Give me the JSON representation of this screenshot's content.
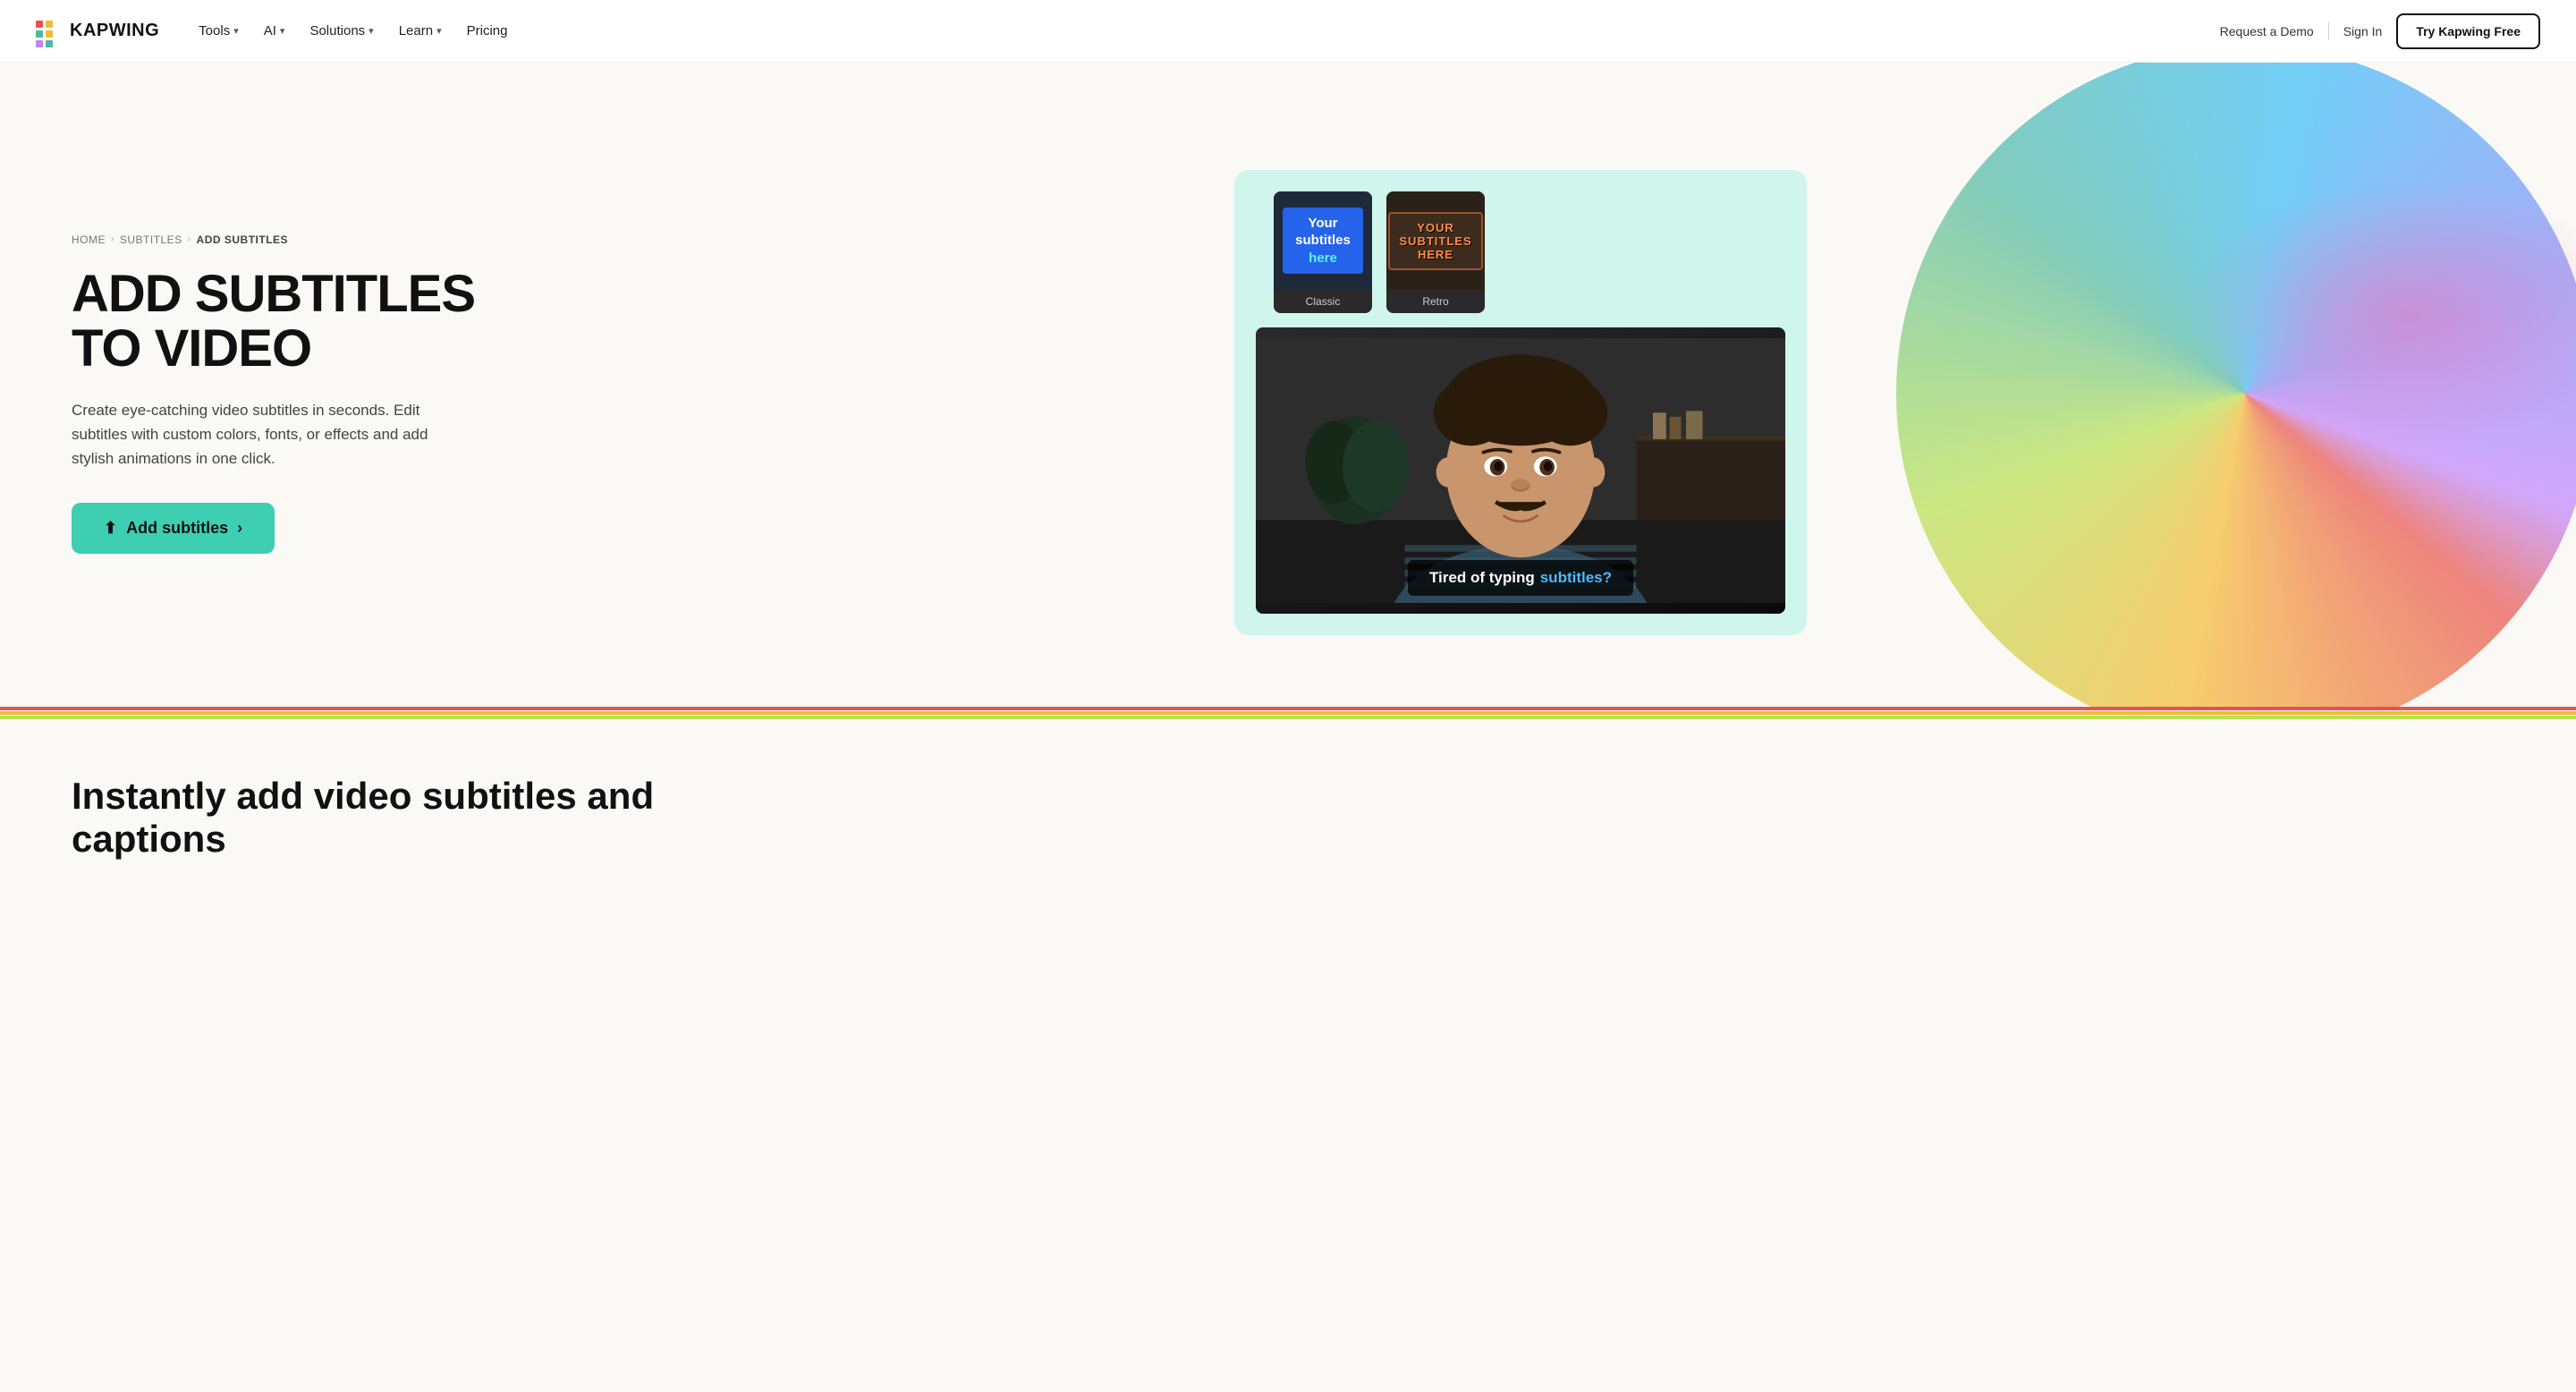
{
  "navbar": {
    "logo_name": "KAPWING",
    "nav_items": [
      {
        "label": "Tools",
        "has_dropdown": true
      },
      {
        "label": "AI",
        "has_dropdown": true
      },
      {
        "label": "Solutions",
        "has_dropdown": true
      },
      {
        "label": "Learn",
        "has_dropdown": true
      },
      {
        "label": "Pricing",
        "has_dropdown": false
      }
    ],
    "request_demo": "Request a Demo",
    "sign_in": "Sign In",
    "try_free": "Try Kapwing Free"
  },
  "breadcrumb": {
    "home": "HOME",
    "subtitles": "SUBTITLES",
    "current": "ADD SUBTITLES"
  },
  "hero": {
    "title_line1": "ADD SUBTITLES",
    "title_line2": "TO VIDEO",
    "description": "Create eye-catching video subtitles in seconds. Edit subtitles with custom colors, fonts, or effects and add stylish animations in one click.",
    "cta_label": "Add subtitles"
  },
  "style_cards": {
    "classic": {
      "label": "Classic",
      "text_line1": "Your",
      "text_line2": "subtitles",
      "text_highlight": "here"
    },
    "retro": {
      "label": "Retro",
      "text": "YOUR SUBTITLES HERE"
    }
  },
  "video": {
    "subtitle_text": "Tired of typing ",
    "subtitle_highlight": "subtitles?"
  },
  "bottom": {
    "title_line1": "Instantly add video subtitles and",
    "title_line2": "captions"
  }
}
